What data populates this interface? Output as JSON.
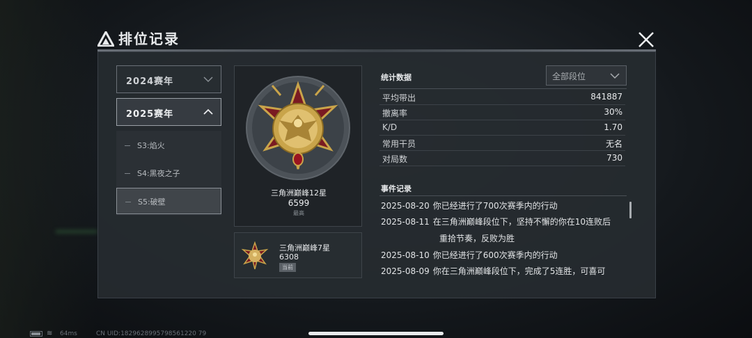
{
  "header": {
    "title": "排位记录",
    "logo_icon": "triangle-logo-icon",
    "close_icon": "close-icon"
  },
  "years": [
    {
      "label": "2024赛年",
      "expanded": false
    },
    {
      "label": "2025赛年",
      "expanded": true
    }
  ],
  "seasons": [
    {
      "label": "S3:焰火",
      "active": false
    },
    {
      "label": "S4:黑夜之子",
      "active": false
    },
    {
      "label": "S5:破壁",
      "active": true
    }
  ],
  "highest_rank": {
    "name": "三角洲巅峰12星",
    "score": "6599",
    "sub": "最高"
  },
  "current_rank": {
    "name": "三角洲巅峰7星",
    "score": "6308",
    "badge": "当前"
  },
  "stats": {
    "title": "统计数据",
    "filter": "全部段位",
    "rows": [
      {
        "label": "平均带出",
        "value": "841887"
      },
      {
        "label": "撤离率",
        "value": "30%"
      },
      {
        "label": "K/D",
        "value": "1.70"
      },
      {
        "label": "常用干员",
        "value": "无名"
      },
      {
        "label": "对局数",
        "value": "730"
      }
    ]
  },
  "events": {
    "title": "事件记录",
    "items": [
      {
        "date": "2025-08-20",
        "text": "你已经进行了700次赛季内的行动"
      },
      {
        "date": "2025-08-11",
        "text": "在三角洲巅峰段位下，坚持不懈的你在10连败后",
        "cont": "重拾节奏，反败为胜"
      },
      {
        "date": "2025-08-10",
        "text": "你已经进行了600次赛季内的行动"
      },
      {
        "date": "2025-08-09",
        "text": "你在三角洲巅峰段位下，完成了5连胜，可喜可"
      }
    ]
  },
  "footer": {
    "ping": "64ms",
    "uid": "CN UID:1829628995798561220 79"
  },
  "colors": {
    "gold": "#c9a44a",
    "crimson": "#7a1a22",
    "panel": "#262b30"
  }
}
